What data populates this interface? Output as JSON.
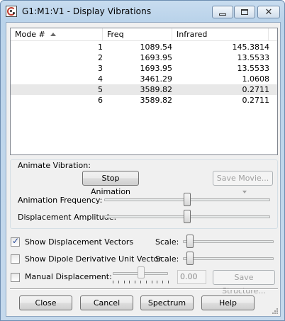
{
  "window": {
    "title": "G1:M1:V1 - Display Vibrations",
    "controls": {
      "minimize": "minimize-icon",
      "maximize": "maximize-icon",
      "close": "✕"
    }
  },
  "list": {
    "columns": [
      "Mode #",
      "Freq",
      "Infrared"
    ],
    "sort_column": "Mode #",
    "rows": [
      {
        "mode": "1",
        "freq": "1089.54",
        "ir": "145.3814"
      },
      {
        "mode": "2",
        "freq": "1693.95",
        "ir": "13.5533"
      },
      {
        "mode": "3",
        "freq": "1693.95",
        "ir": "13.5533"
      },
      {
        "mode": "4",
        "freq": "3461.29",
        "ir": "1.0608"
      },
      {
        "mode": "5",
        "freq": "3589.82",
        "ir": "0.2711"
      },
      {
        "mode": "6",
        "freq": "3589.82",
        "ir": "0.2711"
      }
    ],
    "selected_row": 4
  },
  "animate": {
    "group_label": "Animate Vibration:",
    "stop_button": "Stop Animation",
    "save_movie_button": "Save Movie...",
    "frequency_label": "Animation Frequency:",
    "frequency_level": 0.5,
    "amplitude_label": "Displacement Amplitude:",
    "amplitude_level": 0.5
  },
  "options": {
    "show_displacement_label": "Show Displacement Vectors",
    "show_displacement_checked": true,
    "show_dipole_label": "Show Dipole Derivative Unit Vector",
    "show_dipole_checked": false,
    "scale_label": "Scale:",
    "manual_label": "Manual Displacement:",
    "manual_checked": false,
    "manual_value": "0.00",
    "save_structure_button": "Save Structure..."
  },
  "buttons": {
    "close": "Close",
    "cancel": "Cancel",
    "spectrum": "Spectrum",
    "help": "Help"
  }
}
